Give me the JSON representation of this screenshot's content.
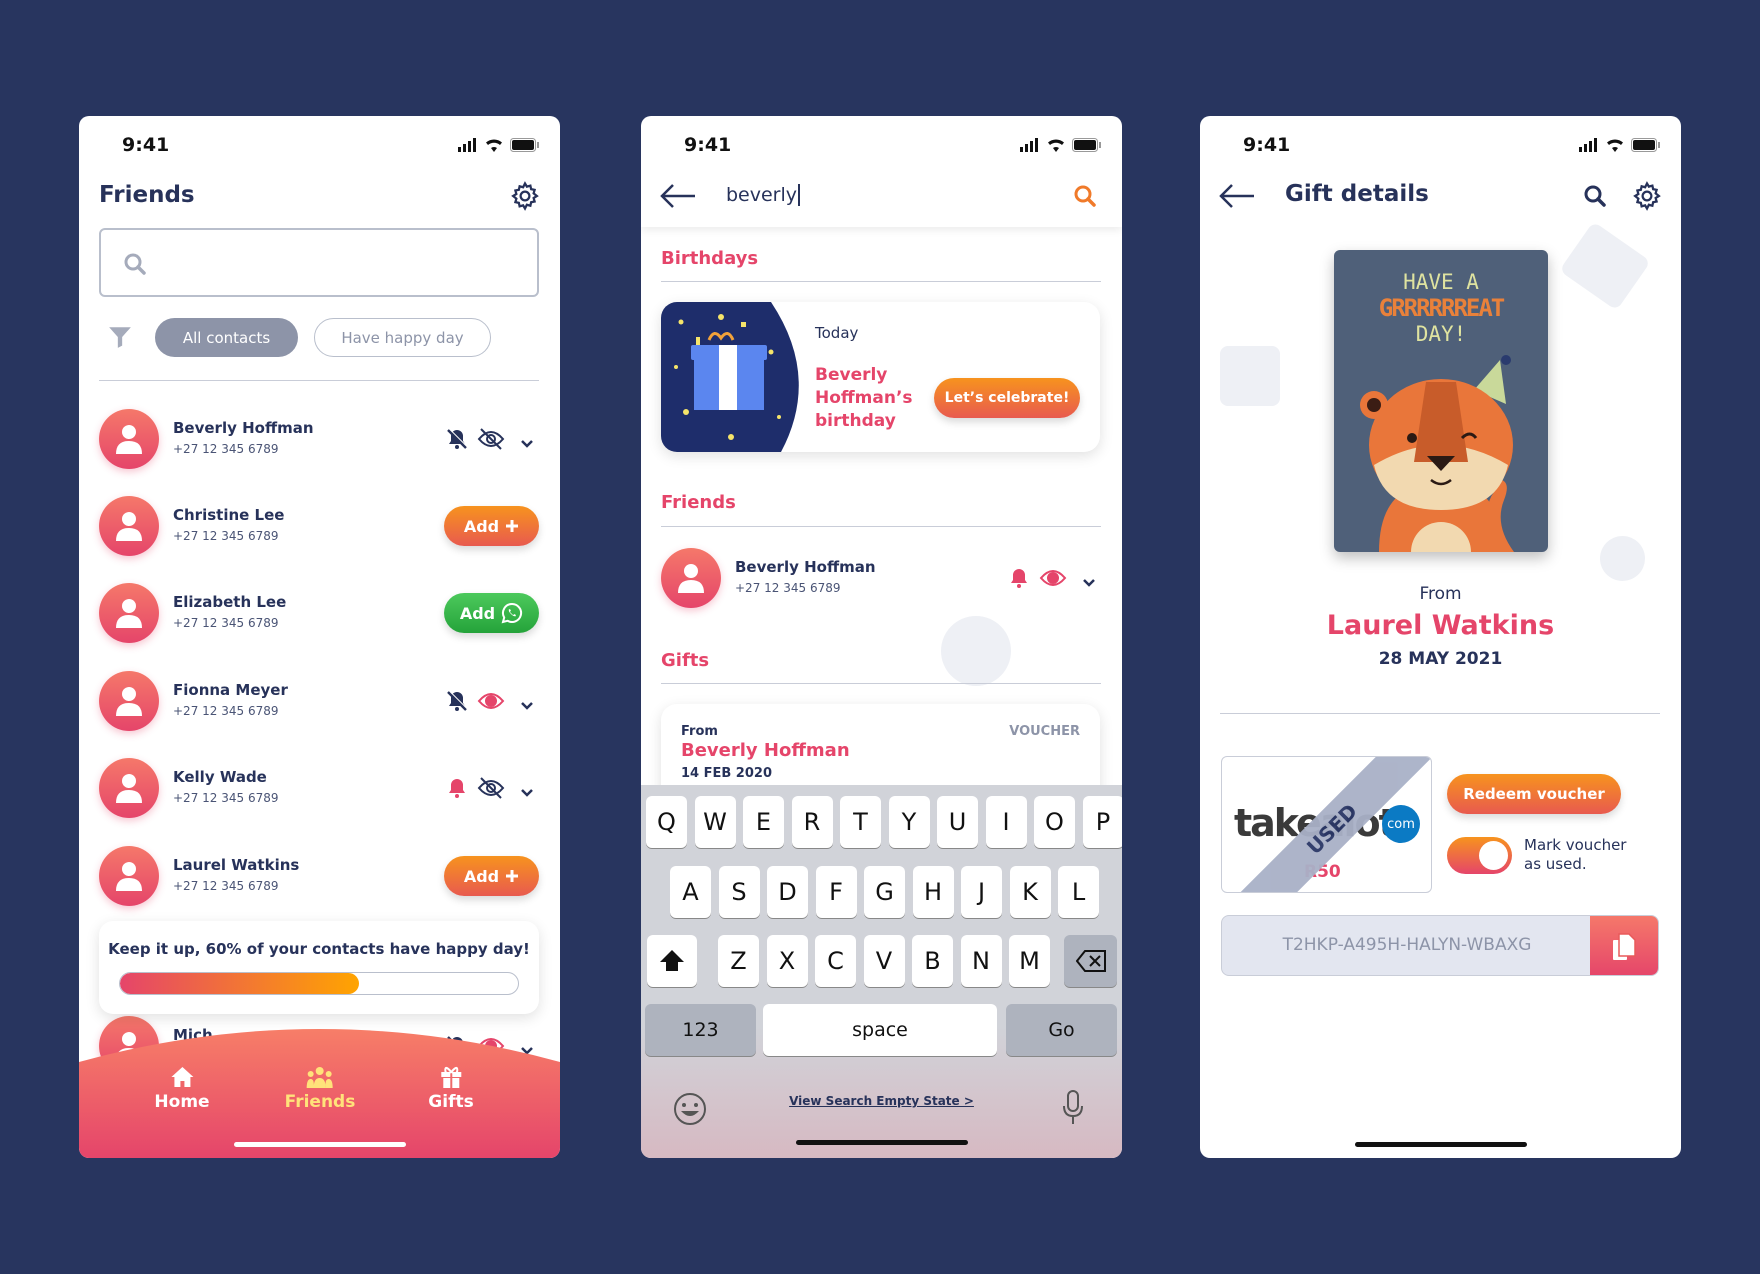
{
  "colors": {
    "background": "#28355f",
    "accent": "#e5456a",
    "orange": "#f7931e",
    "navy": "#27325a",
    "whatsapp": "#25a33a"
  },
  "status_bar": {
    "time": "9:41"
  },
  "friends_screen": {
    "title": "Friends",
    "search": {
      "placeholder": "",
      "value": ""
    },
    "filters": [
      {
        "label": "All contacts",
        "selected": true
      },
      {
        "label": "Have happy day",
        "selected": false
      }
    ],
    "contacts": [
      {
        "name": "Beverly Hoffman",
        "phone": "+27 12 345 6789",
        "action": "toggles",
        "bell": false,
        "eye": false
      },
      {
        "name": "Christine Lee",
        "phone": "+27 12 345 6789",
        "action": "add",
        "label": "Add"
      },
      {
        "name": "Elizabeth Lee",
        "phone": "+27 12 345 6789",
        "action": "whatsapp",
        "label": "Add"
      },
      {
        "name": "Fionna Meyer",
        "phone": "+27 12 345 6789",
        "action": "toggles",
        "bell": false,
        "eye": true
      },
      {
        "name": "Kelly Wade",
        "phone": "+27 12 345 6789",
        "action": "toggles",
        "bell": true,
        "eye": false
      },
      {
        "name": "Laurel Watkins",
        "phone": "+27 12 345 6789",
        "action": "add",
        "label": "Add"
      },
      {
        "name": "Mich",
        "phone": "",
        "action": "toggles",
        "bell": false,
        "eye": true
      }
    ],
    "progress": {
      "message": "Keep it up, 60% of your contacts have happy day!",
      "percent": 60
    },
    "nav": [
      {
        "label": "Home",
        "icon": "home-icon",
        "active": false
      },
      {
        "label": "Friends",
        "icon": "people-icon",
        "active": true
      },
      {
        "label": "Gifts",
        "icon": "gift-icon",
        "active": false
      }
    ]
  },
  "search_screen": {
    "query": "beverly",
    "birthdays_heading": "Birthdays",
    "birthday_card": {
      "when": "Today",
      "line1": "Beverly",
      "line2": "Hoffman’s",
      "line3": "birthday",
      "button": "Let’s celebrate!"
    },
    "friends_heading": "Friends",
    "friend": {
      "name": "Beverly Hoffman",
      "phone": "+27 12 345 6789",
      "bell": true,
      "eye": true
    },
    "gifts_heading": "Gifts",
    "gift": {
      "from_label": "From",
      "from": "Beverly Hoffman",
      "date": "14 FEB 2020",
      "type": "VOUCHER"
    },
    "keyboard": {
      "rows": [
        [
          "Q",
          "W",
          "E",
          "R",
          "T",
          "Y",
          "U",
          "I",
          "O",
          "P"
        ],
        [
          "A",
          "S",
          "D",
          "F",
          "G",
          "H",
          "J",
          "K",
          "L"
        ],
        [
          "Z",
          "X",
          "C",
          "V",
          "B",
          "N",
          "M"
        ]
      ],
      "numbers": "123",
      "space": "space",
      "go": "Go"
    },
    "empty_state_link": "View Search Empty State >"
  },
  "gift_screen": {
    "title": "Gift details",
    "card": {
      "line1": "HAVE A",
      "line2": "GRRRRRREAT",
      "line3": "DAY!"
    },
    "from_label": "From",
    "from": "Laurel Watkins",
    "date": "28 MAY 2021",
    "voucher": {
      "brand": "takealot",
      "brand_suffix": "com",
      "amount": "R50",
      "stamp": "USED"
    },
    "redeem_button": "Redeem voucher",
    "mark_used": {
      "label": "Mark voucher as used.",
      "on": true
    },
    "code": "T2HKP-A495H-HALYN-WBAXG"
  }
}
